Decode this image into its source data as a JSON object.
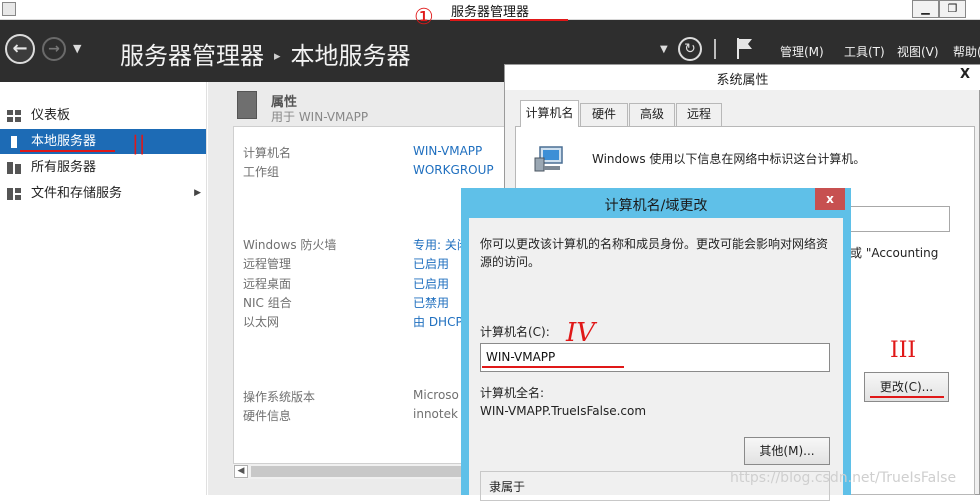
{
  "window": {
    "title": "服务器管理器",
    "minimize": "▁",
    "maximize": "❐"
  },
  "header": {
    "breadcrumb": [
      "服务器管理器",
      "本地服务器"
    ],
    "separator": "▸",
    "menu": [
      "管理(M)",
      "工具(T)",
      "视图(V)",
      "帮助("
    ]
  },
  "sidebar": {
    "items": [
      {
        "label": "仪表板",
        "icon": "dashboard-icon"
      },
      {
        "label": "本地服务器",
        "icon": "server-icon",
        "active": true
      },
      {
        "label": "所有服务器",
        "icon": "servers-icon"
      },
      {
        "label": "文件和存储服务",
        "icon": "storage-icon",
        "expand": "▶"
      }
    ]
  },
  "properties": {
    "title": "属性",
    "subtitle": "用于 WIN-VMAPP",
    "rows": [
      {
        "label": "计算机名",
        "value": "WIN-VMAPP"
      },
      {
        "label": "工作组",
        "value": "WORKGROUP"
      },
      {
        "label": "Windows 防火墙",
        "value": "专用: 关闭"
      },
      {
        "label": "远程管理",
        "value": "已启用"
      },
      {
        "label": "远程桌面",
        "value": "已启用"
      },
      {
        "label": "NIC 组合",
        "value": "已禁用"
      },
      {
        "label": "以太网",
        "value": "由 DHCP"
      },
      {
        "label": "操作系统版本",
        "value": "Microso"
      },
      {
        "label": "硬件信息",
        "value": "innotek"
      }
    ]
  },
  "system_properties": {
    "title": "系统属性",
    "close": "X",
    "tabs": [
      "计算机名",
      "硬件",
      "高级",
      "远程"
    ],
    "description": "Windows 使用以下信息在网络中标识这台计算机。",
    "partial_text": "或 \"Accounting",
    "change_button": "更改(C)..."
  },
  "computer_name_dialog": {
    "title": "计算机名/域更改",
    "close": "x",
    "description": "你可以更改该计算机的名称和成员身份。更改可能会影响对网络资源的访问。",
    "name_label": "计算机名(C):",
    "name_value": "WIN-VMAPP",
    "full_name_label": "计算机全名:",
    "full_name_value": "WIN-VMAPP.TrueIsFalse.com",
    "more_button": "其他(M)...",
    "member_of_label": "隶属于"
  },
  "annotations": {
    "step1": "①",
    "step2": "||",
    "step3": "IV",
    "step4": "III"
  },
  "watermark": "https://blog.csdn.net/TrueIsFalse",
  "colors": {
    "header_bg": "#2e2e2e",
    "sidebar_active": "#1d6bb5",
    "link": "#1f6fbf",
    "dialog_title": "#5fc0e8",
    "close_red": "#c75050",
    "annotation_red": "#e01818"
  }
}
